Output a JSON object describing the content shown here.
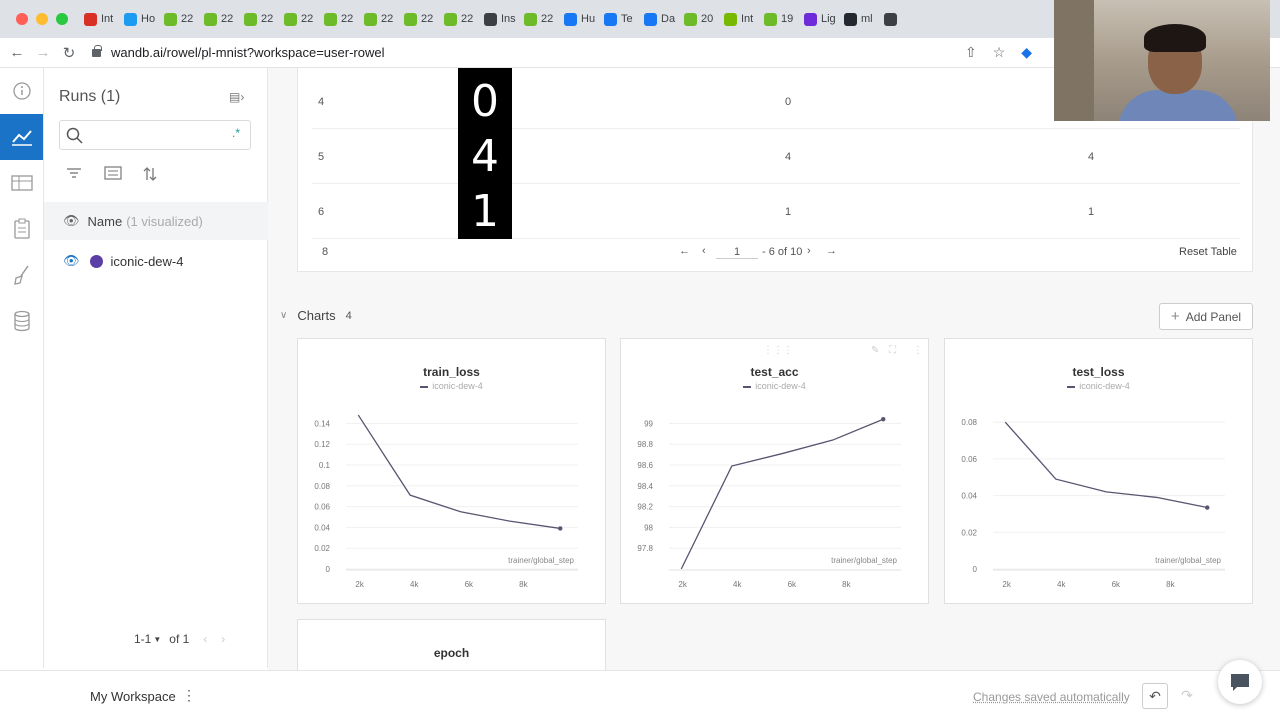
{
  "browser": {
    "tabs": [
      {
        "icon": "gmail-icon",
        "label": "Int",
        "color": "#d93025"
      },
      {
        "icon": "twitter-icon",
        "label": "Ho",
        "color": "#1d9bf0"
      },
      {
        "icon": "lime-icon",
        "label": "22",
        "color": "#6dbb2a"
      },
      {
        "icon": "lime-icon",
        "label": "22",
        "color": "#6dbb2a"
      },
      {
        "icon": "lime-icon",
        "label": "22",
        "color": "#6dbb2a"
      },
      {
        "icon": "lime-icon",
        "label": "22",
        "color": "#6dbb2a"
      },
      {
        "icon": "lime-icon",
        "label": "22",
        "color": "#6dbb2a"
      },
      {
        "icon": "lime-icon",
        "label": "22",
        "color": "#6dbb2a"
      },
      {
        "icon": "lime-icon",
        "label": "22",
        "color": "#6dbb2a"
      },
      {
        "icon": "lime-icon",
        "label": "22",
        "color": "#6dbb2a"
      },
      {
        "icon": "globe-icon",
        "label": "Ins",
        "color": "#3c4043"
      },
      {
        "icon": "lime-icon",
        "label": "22",
        "color": "#6dbb2a"
      },
      {
        "icon": "meta-icon",
        "label": "Hu",
        "color": "#1877f2"
      },
      {
        "icon": "meta-icon",
        "label": "Te",
        "color": "#1877f2"
      },
      {
        "icon": "meta-icon",
        "label": "Da",
        "color": "#1877f2"
      },
      {
        "icon": "lime-icon",
        "label": "20",
        "color": "#6dbb2a"
      },
      {
        "icon": "nvidia-icon",
        "label": "Int",
        "color": "#76b900"
      },
      {
        "icon": "lime-icon",
        "label": "19",
        "color": "#6dbb2a"
      },
      {
        "icon": "hex-icon",
        "label": "Lig",
        "color": "#6e2bd9"
      },
      {
        "icon": "github-icon",
        "label": "ml",
        "color": "#24292f"
      },
      {
        "icon": "globe-icon",
        "label": "",
        "color": "#3c4043"
      }
    ],
    "url": "wandb.ai/rowel/pl-mnist?workspace=user-rowel"
  },
  "runs": {
    "title": "Runs (1)",
    "search_placeholder": "",
    "name_header": "Name",
    "visualized": "(1 visualized)",
    "run_name": "iconic-dew-4",
    "run_color": "#5c3fa6",
    "pager_range": "1-1",
    "pager_total": "of 1"
  },
  "table": {
    "rows": [
      {
        "index": "4",
        "image_digit": "0",
        "prediction": "0",
        "truth": ""
      },
      {
        "index": "5",
        "image_digit": "4",
        "prediction": "4",
        "truth": "4"
      },
      {
        "index": "6",
        "image_digit": "1",
        "prediction": "1",
        "truth": "1"
      }
    ],
    "footer_count": "8",
    "page_current": "1",
    "page_info": "- 6 of 10",
    "reset_label": "Reset Table"
  },
  "charts_section": {
    "label": "Charts",
    "count": "4",
    "add_panel_label": "Add Panel"
  },
  "chart_data": [
    {
      "type": "line",
      "title": "train_loss",
      "legend": "iconic-dew-4",
      "xlabel": "trainer/global_step",
      "x": [
        1950,
        3850,
        5700,
        7500,
        9350
      ],
      "y": [
        0.148,
        0.071,
        0.055,
        0.046,
        0.039
      ],
      "xlim": [
        1500,
        10000
      ],
      "ylim": [
        0,
        0.15
      ],
      "xticks": [
        2000,
        4000,
        6000,
        8000
      ],
      "xtick_labels": [
        "2k",
        "4k",
        "6k",
        "8k"
      ],
      "yticks": [
        0,
        0.02,
        0.04,
        0.06,
        0.08,
        0.1,
        0.12,
        0.14
      ],
      "ytick_labels": [
        "0",
        "0.02",
        "0.04",
        "0.06",
        "0.08",
        "0.1",
        "0.12",
        "0.14"
      ]
    },
    {
      "type": "line",
      "title": "test_acc",
      "legend": "iconic-dew-4",
      "xlabel": "trainer/global_step",
      "x": [
        1950,
        3800,
        5650,
        7500,
        9350
      ],
      "y": [
        97.6,
        98.59,
        98.71,
        98.84,
        99.04
      ],
      "xlim": [
        1500,
        10000
      ],
      "ylim": [
        97.6,
        99.1
      ],
      "xticks": [
        2000,
        4000,
        6000,
        8000
      ],
      "xtick_labels": [
        "2k",
        "4k",
        "6k",
        "8k"
      ],
      "yticks": [
        97.8,
        98,
        98.2,
        98.4,
        98.6,
        98.8,
        99
      ],
      "ytick_labels": [
        "97.8",
        "98",
        "98.2",
        "98.4",
        "98.6",
        "98.8",
        "99"
      ]
    },
    {
      "type": "line",
      "title": "test_loss",
      "legend": "iconic-dew-4",
      "xlabel": "trainer/global_step",
      "x": [
        1950,
        3800,
        5650,
        7500,
        9350
      ],
      "y": [
        0.08,
        0.049,
        0.042,
        0.039,
        0.0335
      ],
      "xlim": [
        1500,
        10000
      ],
      "ylim": [
        0,
        0.085
      ],
      "xticks": [
        2000,
        4000,
        6000,
        8000
      ],
      "xtick_labels": [
        "2k",
        "4k",
        "6k",
        "8k"
      ],
      "yticks": [
        0,
        0.02,
        0.04,
        0.06,
        0.08
      ],
      "ytick_labels": [
        "0",
        "0.02",
        "0.04",
        "0.06",
        "0.08"
      ]
    }
  ],
  "epoch_chart": {
    "title": "epoch"
  },
  "bottom": {
    "workspace": "My Workspace",
    "status": "Changes saved automatically"
  },
  "colors": {
    "accent": "#1a73c6",
    "line": "#5b5370"
  }
}
